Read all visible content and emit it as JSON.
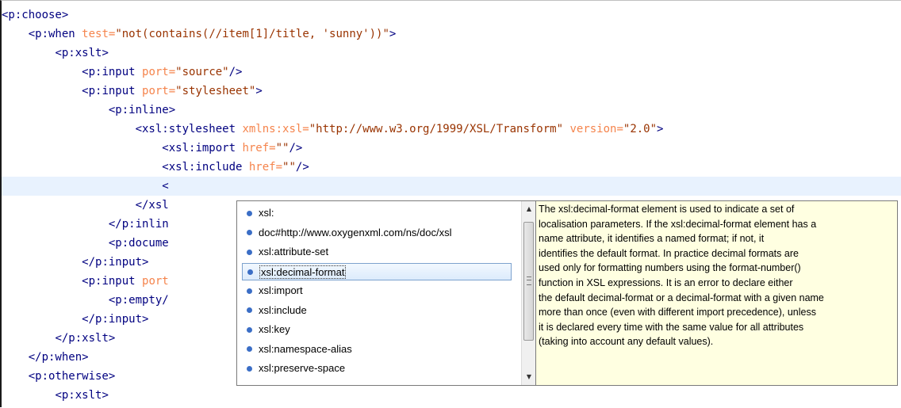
{
  "editor": {
    "lines": [
      {
        "indent": "",
        "segments": [
          {
            "t": "tag",
            "v": "<p:choose>"
          }
        ]
      },
      {
        "indent": "    ",
        "segments": [
          {
            "t": "tag",
            "v": "<p:when "
          },
          {
            "t": "attr",
            "v": "test="
          },
          {
            "t": "val",
            "v": "\"not(contains(//item[1]/title, 'sunny'))\""
          },
          {
            "t": "tag",
            "v": ">"
          }
        ]
      },
      {
        "indent": "        ",
        "segments": [
          {
            "t": "tag",
            "v": "<p:xslt>"
          }
        ]
      },
      {
        "indent": "            ",
        "segments": [
          {
            "t": "tag",
            "v": "<p:input "
          },
          {
            "t": "attr",
            "v": "port="
          },
          {
            "t": "val",
            "v": "\"source\""
          },
          {
            "t": "tag",
            "v": "/>"
          }
        ]
      },
      {
        "indent": "            ",
        "segments": [
          {
            "t": "tag",
            "v": "<p:input "
          },
          {
            "t": "attr",
            "v": "port="
          },
          {
            "t": "val",
            "v": "\"stylesheet\""
          },
          {
            "t": "tag",
            "v": ">"
          }
        ]
      },
      {
        "indent": "                ",
        "segments": [
          {
            "t": "tag",
            "v": "<p:inline>"
          }
        ]
      },
      {
        "indent": "                    ",
        "segments": [
          {
            "t": "tag",
            "v": "<xsl:stylesheet "
          },
          {
            "t": "attr",
            "v": "xmlns:xsl="
          },
          {
            "t": "val",
            "v": "\"http://www.w3.org/1999/XSL/Transform\""
          },
          {
            "t": "attr",
            "v": " version="
          },
          {
            "t": "val",
            "v": "\"2.0\""
          },
          {
            "t": "tag",
            "v": ">"
          }
        ]
      },
      {
        "indent": "                        ",
        "segments": [
          {
            "t": "tag",
            "v": "<xsl:import "
          },
          {
            "t": "attr",
            "v": "href="
          },
          {
            "t": "val",
            "v": "\"\""
          },
          {
            "t": "tag",
            "v": "/>"
          }
        ]
      },
      {
        "indent": "                        ",
        "segments": [
          {
            "t": "tag",
            "v": "<xsl:include "
          },
          {
            "t": "attr",
            "v": "href="
          },
          {
            "t": "val",
            "v": "\"\""
          },
          {
            "t": "tag",
            "v": "/>"
          }
        ]
      },
      {
        "indent": "                        ",
        "current": true,
        "segments": [
          {
            "t": "tag",
            "v": "<"
          }
        ]
      },
      {
        "indent": "                    ",
        "segments": [
          {
            "t": "tag",
            "v": "</xsl"
          }
        ]
      },
      {
        "indent": "                ",
        "segments": [
          {
            "t": "tag",
            "v": "</p:inlin"
          }
        ]
      },
      {
        "indent": "                ",
        "segments": [
          {
            "t": "tag",
            "v": "<p:docume"
          }
        ]
      },
      {
        "indent": "            ",
        "segments": [
          {
            "t": "tag",
            "v": "</p:input>"
          }
        ]
      },
      {
        "indent": "            ",
        "segments": [
          {
            "t": "tag",
            "v": "<p:input "
          },
          {
            "t": "attr",
            "v": "port"
          }
        ]
      },
      {
        "indent": "                ",
        "segments": [
          {
            "t": "tag",
            "v": "<p:empty/"
          }
        ]
      },
      {
        "indent": "            ",
        "segments": [
          {
            "t": "tag",
            "v": "</p:input>"
          }
        ]
      },
      {
        "indent": "        ",
        "segments": [
          {
            "t": "tag",
            "v": "</p:xslt>"
          }
        ]
      },
      {
        "indent": "    ",
        "segments": [
          {
            "t": "tag",
            "v": "</p:when>"
          }
        ]
      },
      {
        "indent": "    ",
        "segments": [
          {
            "t": "tag",
            "v": "<p:otherwise>"
          }
        ]
      },
      {
        "indent": "        ",
        "segments": [
          {
            "t": "tag",
            "v": "<p:xslt>"
          }
        ]
      }
    ]
  },
  "completion": {
    "items": [
      {
        "label": "xsl:"
      },
      {
        "label": "doc#http://www.oxygenxml.com/ns/doc/xsl"
      },
      {
        "label": "xsl:attribute-set"
      },
      {
        "label": "xsl:decimal-format",
        "selected": true
      },
      {
        "label": "xsl:import"
      },
      {
        "label": "xsl:include"
      },
      {
        "label": "xsl:key"
      },
      {
        "label": "xsl:namespace-alias"
      },
      {
        "label": "xsl:preserve-space"
      }
    ],
    "scrollbar": {
      "up": "▲",
      "down": "▼"
    },
    "icon": "element-bullet-icon"
  },
  "documentation": {
    "lines": [
      "The xsl:decimal-format element is used to indicate a set of",
      "localisation parameters. If the xsl:decimal-format element has a",
      "name attribute, it identifies a named format; if not, it",
      "identifies the default format. In practice decimal formats are",
      "used only for formatting numbers using the format-number()",
      "function in XSL expressions. It is an error to declare either",
      "the default decimal-format or a decimal-format with a given name",
      "more than once (even with different import precedence), unless",
      "it is declared every time with the same value for all attributes",
      "(taking into account any default values)."
    ]
  }
}
